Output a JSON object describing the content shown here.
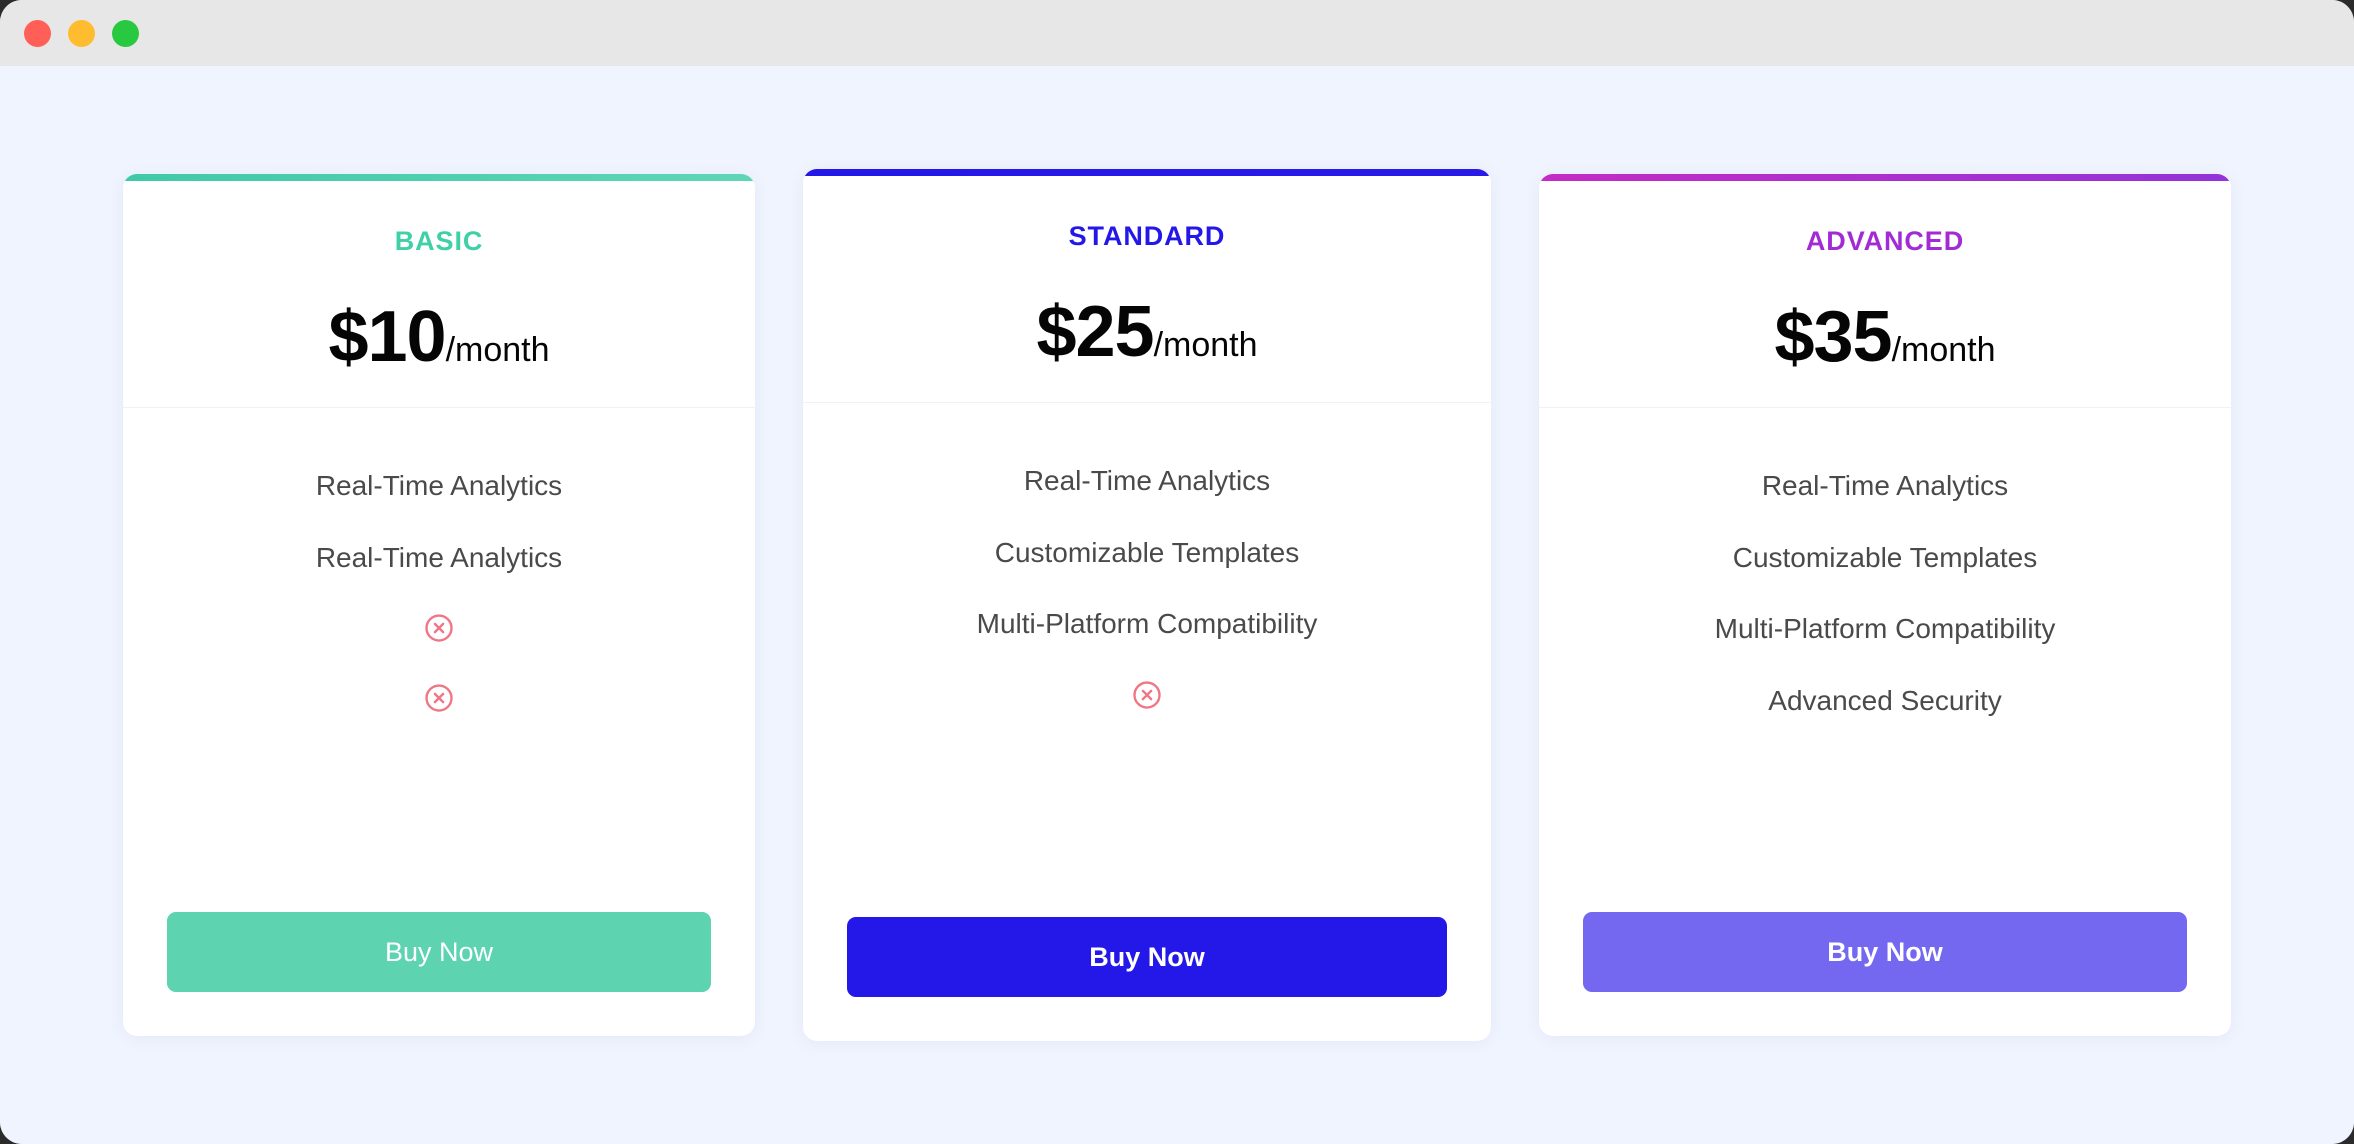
{
  "window": {
    "traffic_lights": [
      {
        "name": "close",
        "color": "#ff5f57"
      },
      {
        "name": "minimize",
        "color": "#febc2e"
      },
      {
        "name": "maximize",
        "color": "#28c840"
      }
    ],
    "background": "#f0f4fe"
  },
  "plans": [
    {
      "id": "basic",
      "name": "BASIC",
      "accent": "#55cfb0",
      "accent_gradient": "linear-gradient(90deg, #3fc9a8 0%, #5fd6b6 100%)",
      "name_color": "#3fd0a8",
      "price_amount": "$10",
      "price_period": "/month",
      "button_label": "Buy Now",
      "button_color": "#5dd3b0",
      "features": [
        {
          "type": "text",
          "label": "Real-Time Analytics"
        },
        {
          "type": "text",
          "label": "Real-Time Analytics"
        },
        {
          "type": "icon",
          "icon": "circle-x-icon",
          "label": ""
        },
        {
          "type": "icon",
          "icon": "circle-x-icon",
          "label": ""
        }
      ]
    },
    {
      "id": "standard",
      "name": "STANDARD",
      "accent": "#2318e8",
      "accent_gradient": "linear-gradient(90deg, #2318e8 0%, #2a1ae8 100%)",
      "name_color": "#2318e8",
      "price_amount": "$25",
      "price_period": "/month",
      "button_label": "Buy Now",
      "button_color": "#2318e8",
      "features": [
        {
          "type": "text",
          "label": "Real-Time Analytics"
        },
        {
          "type": "text",
          "label": "Customizable Templates"
        },
        {
          "type": "text",
          "label": "Multi-Platform Compatibility"
        },
        {
          "type": "icon",
          "icon": "circle-x-icon",
          "label": ""
        }
      ]
    },
    {
      "id": "advanced",
      "name": "ADVANCED",
      "accent": "#a32bd6",
      "accent_gradient": "linear-gradient(90deg, #c42bc4 0%, #9333d8 100%)",
      "name_color": "#a32bd6",
      "price_amount": "$35",
      "price_period": "/month",
      "button_label": "Buy Now",
      "button_color": "#7468f0",
      "features": [
        {
          "type": "text",
          "label": "Real-Time Analytics"
        },
        {
          "type": "text",
          "label": "Customizable Templates"
        },
        {
          "type": "text",
          "label": "Multi-Platform Compatibility"
        },
        {
          "type": "text",
          "label": "Advanced Security"
        }
      ]
    }
  ],
  "icons": {
    "unavailable_color": "#ef7685"
  }
}
